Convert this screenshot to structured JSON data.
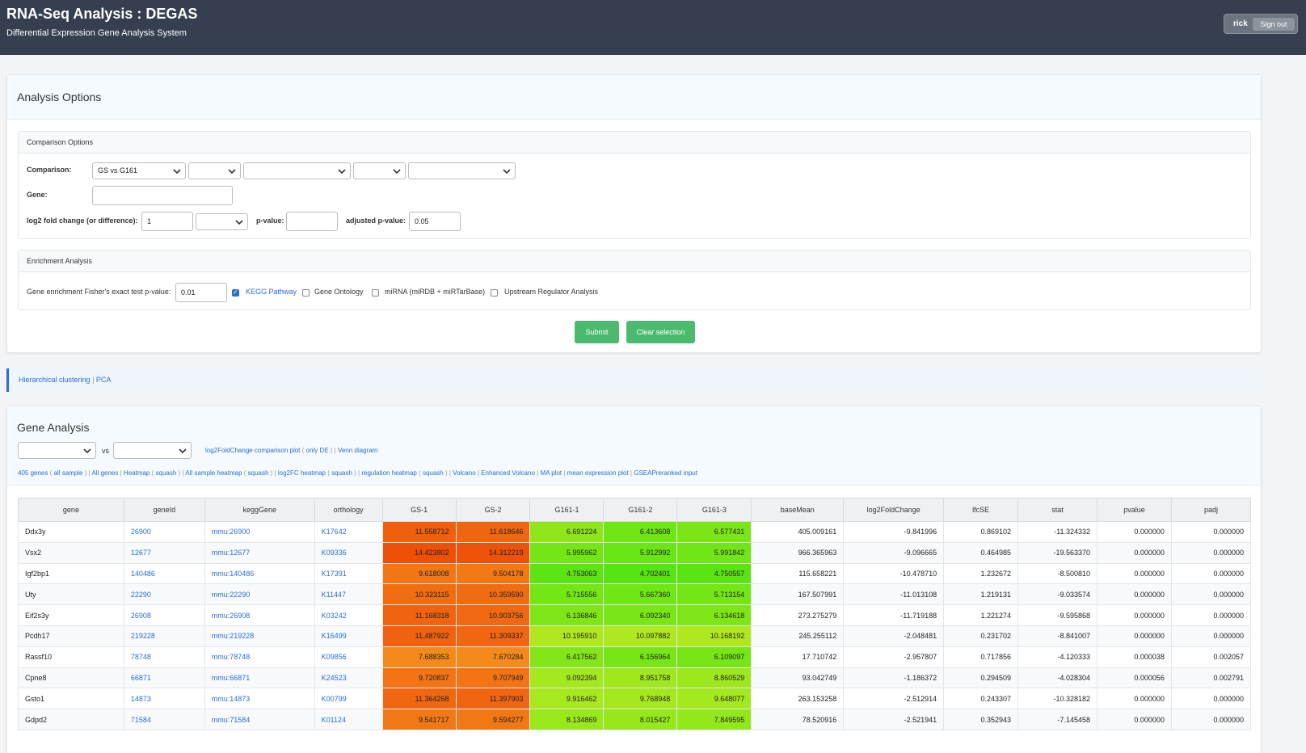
{
  "header": {
    "title": "RNA-Seq Analysis : DEGAS",
    "subtitle": "Differential Expression Gene Analysis System",
    "user": "rick",
    "sign_out": "Sign out"
  },
  "analysis_options": {
    "title": "Analysis Options",
    "comparison_options": {
      "title": "Comparison Options",
      "comparison_label": "Comparison:",
      "comparison_value": "GS vs G161",
      "gene_label": "Gene:",
      "gene_value": "",
      "log2fc_label": "log2 fold change (or difference):",
      "log2fc_value": "1",
      "pvalue_label": "p-value:",
      "pvalue_value": "",
      "adj_pvalue_label": "adjusted p-value:",
      "adj_pvalue_value": "0.05"
    },
    "enrichment": {
      "title": "Enrichment Analysis",
      "fisher_label": "Gene enrichment Fisher's exact test p-value:",
      "fisher_value": "0.01",
      "kegg": "KEGG Pathway",
      "kegg_checked": true,
      "go": "Gene Ontology",
      "mirna": "miRNA (miRDB + miRTarBase)",
      "upstream": "Upstream Regulator Analysis"
    },
    "submit": "Submit",
    "clear": "Clear selection"
  },
  "links": {
    "clustering": "Hierarchical clustering",
    "sep": "|",
    "pca": "PCA"
  },
  "gene_analysis": {
    "title": "Gene Analysis",
    "vs": "vs",
    "plot_links": {
      "log2fc_plot": "log2FoldChange comparison plot",
      "only_de": "only DE",
      "venn": "Venn diagram"
    },
    "toolbar": {
      "genes_count": "405 genes",
      "all_sample": "all sample",
      "all_genes": "All genes",
      "heatmap": "Heatmap",
      "squash1": "squash",
      "all_sample_heatmap": "All sample heatmap",
      "squash2": "squash",
      "log2fc_heatmap": "log2FC heatmap",
      "squash3": "squash",
      "regulation_heatmap": "regulation heatmap",
      "squash4": "squash",
      "volcano": "Volcano",
      "enhanced_volcano": "Enhanced Volcano",
      "ma_plot": "MA plot",
      "mean_expr": "mean expression plot",
      "gsea": "GSEAPreranked input"
    },
    "columns": [
      "gene",
      "geneId",
      "keggGene",
      "orthology",
      "GS-1",
      "GS-2",
      "G161-1",
      "G161-2",
      "G161-3",
      "baseMean",
      "log2FoldChange",
      "lfcSE",
      "stat",
      "pvalue",
      "padj"
    ],
    "rows": [
      [
        "Ddx3y",
        "26900",
        "mmu:26900",
        "K17642",
        "11.558712",
        "11.618646",
        "6.691224",
        "6.413608",
        "6.577431",
        "405.009161",
        "-9.841996",
        "0.869102",
        "-11.324332",
        "0.000000",
        "0.000000"
      ],
      [
        "Vsx2",
        "12677",
        "mmu:12677",
        "K09336",
        "14.423802",
        "14.312219",
        "5.995962",
        "5.912992",
        "5.991842",
        "966.365963",
        "-9.096665",
        "0.464985",
        "-19.563370",
        "0.000000",
        "0.000000"
      ],
      [
        "Igf2bp1",
        "140486",
        "mmu:140486",
        "K17391",
        "9.618008",
        "9.504178",
        "4.753063",
        "4.702401",
        "4.750557",
        "115.658221",
        "-10.478710",
        "1.232672",
        "-8.500810",
        "0.000000",
        "0.000000"
      ],
      [
        "Uty",
        "22290",
        "mmu:22290",
        "K11447",
        "10.323115",
        "10.359590",
        "5.715556",
        "5.667360",
        "5.713154",
        "167.507991",
        "-11.013108",
        "1.219131",
        "-9.033574",
        "0.000000",
        "0.000000"
      ],
      [
        "Eif2s3y",
        "26908",
        "mmu:26908",
        "K03242",
        "11.168318",
        "10.903756",
        "6.136846",
        "6.092340",
        "6.134618",
        "273.275279",
        "-11.719188",
        "1.221274",
        "-9.595868",
        "0.000000",
        "0.000000"
      ],
      [
        "Pcdh17",
        "219228",
        "mmu:219228",
        "K16499",
        "11.487922",
        "11.309337",
        "10.195910",
        "10.097882",
        "10.168192",
        "245.255112",
        "-2.048481",
        "0.231702",
        "-8.841007",
        "0.000000",
        "0.000000"
      ],
      [
        "Rassf10",
        "78748",
        "mmu:78748",
        "K09856",
        "7.688353",
        "7.670284",
        "6.417562",
        "6.156964",
        "6.109097",
        "17.710742",
        "-2.957807",
        "0.717856",
        "-4.120333",
        "0.000038",
        "0.002057"
      ],
      [
        "Cpne8",
        "66871",
        "mmu:66871",
        "K24523",
        "9.720837",
        "9.707949",
        "9.092394",
        "8.951758",
        "8.860529",
        "93.042749",
        "-1.186372",
        "0.294509",
        "-4.028304",
        "0.000056",
        "0.002791"
      ],
      [
        "Gsto1",
        "14873",
        "mmu:14873",
        "K00799",
        "11.364268",
        "11.397903",
        "9.916462",
        "9.768948",
        "9.648077",
        "263.153258",
        "-2.512914",
        "0.243307",
        "-10.328182",
        "0.000000",
        "0.000000"
      ],
      [
        "Gdpd2",
        "71584",
        "mmu:71584",
        "K01124",
        "9.541717",
        "9.594277",
        "8.134869",
        "8.015427",
        "7.849595",
        "78.520916",
        "-2.521941",
        "0.352943",
        "-7.145458",
        "0.000000",
        "0.000000"
      ]
    ],
    "heat_colors": {
      "rows": [
        [
          "#f0600c",
          "#f0650f",
          "#8ee61a",
          "#6ee616",
          "#7ae617"
        ],
        [
          "#ee5008",
          "#ee5209",
          "#73e616",
          "#6ae615",
          "#70e616"
        ],
        [
          "#f27714",
          "#f27914",
          "#5ce413",
          "#56e412",
          "#5ae412"
        ],
        [
          "#f06d10",
          "#f06c10",
          "#74e616",
          "#70e616",
          "#74e616"
        ],
        [
          "#f06310",
          "#f06912",
          "#7ee617",
          "#7ae617",
          "#7ee617"
        ],
        [
          "#f06210",
          "#f06612",
          "#b0e820",
          "#aee820",
          "#b0e820"
        ],
        [
          "#f48a1a",
          "#f48a1a",
          "#82e618",
          "#78e616",
          "#76e616"
        ],
        [
          "#f27414",
          "#f27414",
          "#a4e81e",
          "#a0e81d",
          "#9ce81c"
        ],
        [
          "#f06611",
          "#f06511",
          "#a8e81f",
          "#a6e81e",
          "#a4e81e"
        ],
        [
          "#f27815",
          "#f27715",
          "#98e81c",
          "#96e81b",
          "#92e81a"
        ]
      ]
    }
  }
}
